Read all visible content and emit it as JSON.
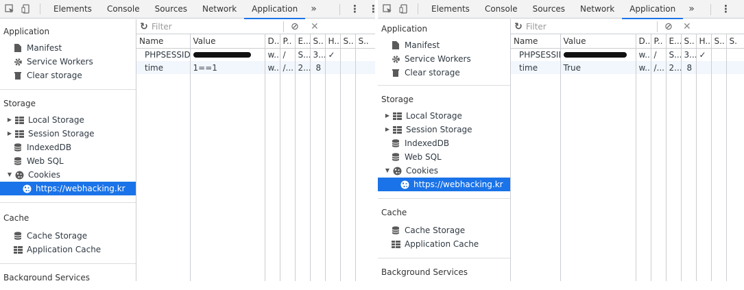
{
  "toolbar": {
    "tabs": [
      "Elements",
      "Console",
      "Sources",
      "Network",
      "Application"
    ],
    "active_tab": "Application",
    "more": "»",
    "kebab": "⋮"
  },
  "sidebar": {
    "application": {
      "header": "Application",
      "items": [
        "Manifest",
        "Service Workers",
        "Clear storage"
      ]
    },
    "storage": {
      "header": "Storage",
      "items": [
        "Local Storage",
        "Session Storage",
        "IndexedDB",
        "Web SQL",
        "Cookies"
      ],
      "cookie_origin": "https://webhacking.kr"
    },
    "cache": {
      "header": "Cache",
      "items": [
        "Cache Storage",
        "Application Cache"
      ]
    },
    "background": {
      "header": "Background Services"
    }
  },
  "filter": {
    "placeholder": "Filter"
  },
  "table": {
    "columns_left": [
      "Name",
      "Value",
      "D..",
      "P..",
      "E...",
      "S..",
      "H..",
      "S..",
      "S.."
    ],
    "columns_right": [
      "Name",
      "Value",
      "D..",
      "P..",
      "E...",
      "S..",
      "H..",
      "S..",
      "S."
    ],
    "left_rows": [
      [
        "PHPSESSID",
        "",
        "w...",
        "/",
        "S...",
        "3...",
        "✓",
        "",
        ""
      ],
      [
        "time",
        "1==1",
        "w...",
        "/...",
        "2...",
        "8",
        "",
        "",
        ""
      ]
    ],
    "right_rows": [
      [
        "PHPSESSID",
        "",
        "w...",
        "/",
        "S...",
        "3...",
        "✓",
        "",
        ""
      ],
      [
        "time",
        "True",
        "w...",
        "/...",
        "2...",
        "8",
        "",
        "",
        ""
      ]
    ]
  }
}
